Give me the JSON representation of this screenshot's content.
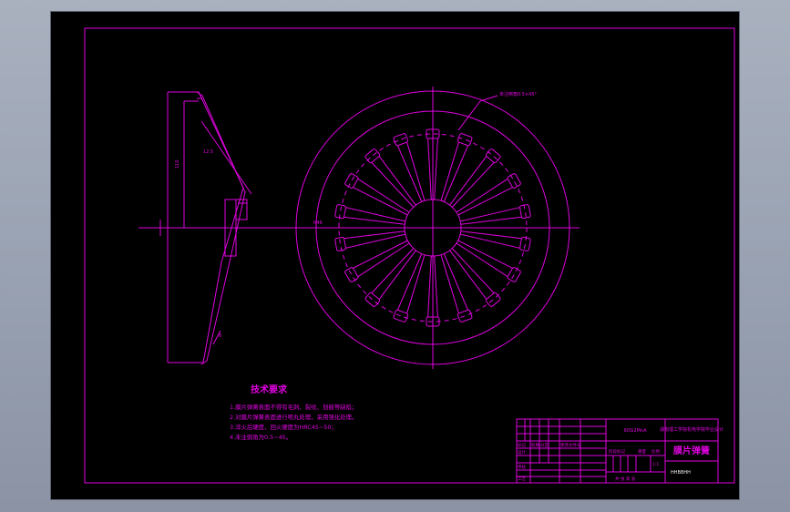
{
  "drawing": {
    "leader_label": "未注倒角0.5×45°",
    "dim_side_1": "12.5",
    "dim_side_2": "110",
    "dim_side_3": "8",
    "dim_front_r": "R46"
  },
  "technical_requirements": {
    "title": "技术要求",
    "items": [
      "1.膜片弹簧表面不得有毛刺、裂纹、划痕等缺陷；",
      "2.对膜片弹簧表面进行喷丸处理，采用强化处理。",
      "3.淬火后硬度，回火硬度为HRC45~50；",
      "4.未注倒角为0.5~45。"
    ]
  },
  "title_block": {
    "drawing_number": "HHBBHH",
    "part_name": "膜片弹簧",
    "school": "湖南理工学院机电学院毕业设计",
    "material": "60Si2MnA",
    "labels": {
      "mark": "标记",
      "count": "处数",
      "zone": "分区",
      "change_doc": "更改文件号",
      "designer": "设计",
      "checker": "审核",
      "process": "工艺",
      "stage_mark": "阶段标记",
      "weight": "重量",
      "scale": "比例",
      "sheet": "共 张 第 张",
      "scale_value": "1:1"
    }
  }
}
